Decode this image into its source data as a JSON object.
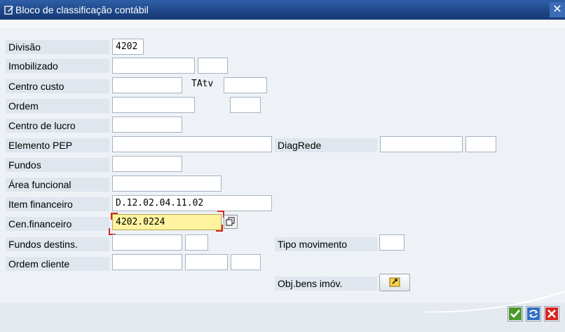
{
  "window": {
    "title": "Bloco de classificação contábil",
    "close_symbol": "✕",
    "icons": [
      "document-edit-icon",
      "close-icon"
    ]
  },
  "labels": {
    "divisao": "Divisão",
    "imobilizado": "Imobilizado",
    "centro_custo": "Centro custo",
    "tatv": "TAtv",
    "ordem": "Ordem",
    "centro_lucro": "Centro de lucro",
    "elemento_pep": "Elemento PEP",
    "diagrede": "DiagRede",
    "fundos": "Fundos",
    "area_funcional": "Área funcional",
    "item_financeiro": "Item financeiro",
    "cen_financeiro": "Cen.financeiro",
    "fundos_destins": "Fundos destins.",
    "tipo_movimento": "Tipo movimento",
    "ordem_cliente": "Ordem cliente",
    "obj_bens": "Obj.bens imóv."
  },
  "values": {
    "divisao": "4202",
    "item_financeiro": "D.12.02.04.11.02",
    "cen_financeiro": "4202.0224"
  },
  "icons": {
    "possible_entries": "f4-help-icon",
    "obj_bens": "navigate-arrow-icon",
    "confirm": "checkmark-icon",
    "refresh": "refresh-icon",
    "cancel": "cancel-icon"
  },
  "colors": {
    "titlebar": "#1d4585",
    "focus_field": "#fff3a0",
    "focus_marker": "#d7261f",
    "label_bg": "#dfe6ee"
  }
}
